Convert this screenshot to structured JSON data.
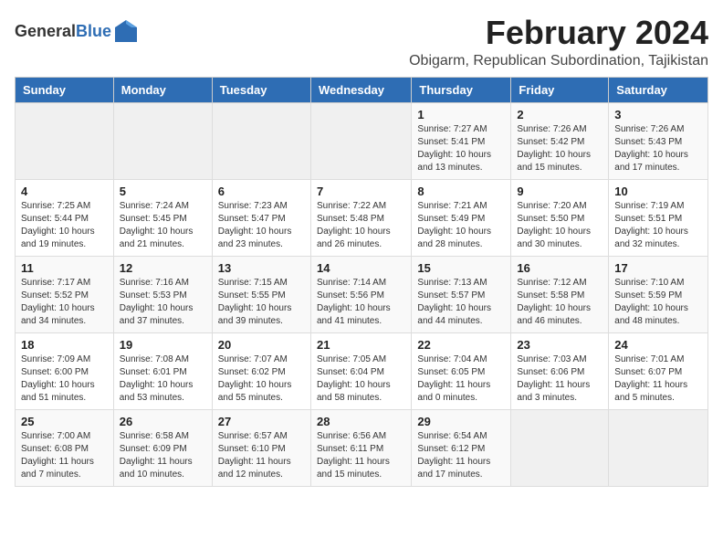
{
  "header": {
    "logo_general": "General",
    "logo_blue": "Blue",
    "month_title": "February 2024",
    "location": "Obigarm, Republican Subordination, Tajikistan"
  },
  "weekdays": [
    "Sunday",
    "Monday",
    "Tuesday",
    "Wednesday",
    "Thursday",
    "Friday",
    "Saturday"
  ],
  "weeks": [
    [
      {
        "day": "",
        "info": ""
      },
      {
        "day": "",
        "info": ""
      },
      {
        "day": "",
        "info": ""
      },
      {
        "day": "",
        "info": ""
      },
      {
        "day": "1",
        "info": "Sunrise: 7:27 AM\nSunset: 5:41 PM\nDaylight: 10 hours\nand 13 minutes."
      },
      {
        "day": "2",
        "info": "Sunrise: 7:26 AM\nSunset: 5:42 PM\nDaylight: 10 hours\nand 15 minutes."
      },
      {
        "day": "3",
        "info": "Sunrise: 7:26 AM\nSunset: 5:43 PM\nDaylight: 10 hours\nand 17 minutes."
      }
    ],
    [
      {
        "day": "4",
        "info": "Sunrise: 7:25 AM\nSunset: 5:44 PM\nDaylight: 10 hours\nand 19 minutes."
      },
      {
        "day": "5",
        "info": "Sunrise: 7:24 AM\nSunset: 5:45 PM\nDaylight: 10 hours\nand 21 minutes."
      },
      {
        "day": "6",
        "info": "Sunrise: 7:23 AM\nSunset: 5:47 PM\nDaylight: 10 hours\nand 23 minutes."
      },
      {
        "day": "7",
        "info": "Sunrise: 7:22 AM\nSunset: 5:48 PM\nDaylight: 10 hours\nand 26 minutes."
      },
      {
        "day": "8",
        "info": "Sunrise: 7:21 AM\nSunset: 5:49 PM\nDaylight: 10 hours\nand 28 minutes."
      },
      {
        "day": "9",
        "info": "Sunrise: 7:20 AM\nSunset: 5:50 PM\nDaylight: 10 hours\nand 30 minutes."
      },
      {
        "day": "10",
        "info": "Sunrise: 7:19 AM\nSunset: 5:51 PM\nDaylight: 10 hours\nand 32 minutes."
      }
    ],
    [
      {
        "day": "11",
        "info": "Sunrise: 7:17 AM\nSunset: 5:52 PM\nDaylight: 10 hours\nand 34 minutes."
      },
      {
        "day": "12",
        "info": "Sunrise: 7:16 AM\nSunset: 5:53 PM\nDaylight: 10 hours\nand 37 minutes."
      },
      {
        "day": "13",
        "info": "Sunrise: 7:15 AM\nSunset: 5:55 PM\nDaylight: 10 hours\nand 39 minutes."
      },
      {
        "day": "14",
        "info": "Sunrise: 7:14 AM\nSunset: 5:56 PM\nDaylight: 10 hours\nand 41 minutes."
      },
      {
        "day": "15",
        "info": "Sunrise: 7:13 AM\nSunset: 5:57 PM\nDaylight: 10 hours\nand 44 minutes."
      },
      {
        "day": "16",
        "info": "Sunrise: 7:12 AM\nSunset: 5:58 PM\nDaylight: 10 hours\nand 46 minutes."
      },
      {
        "day": "17",
        "info": "Sunrise: 7:10 AM\nSunset: 5:59 PM\nDaylight: 10 hours\nand 48 minutes."
      }
    ],
    [
      {
        "day": "18",
        "info": "Sunrise: 7:09 AM\nSunset: 6:00 PM\nDaylight: 10 hours\nand 51 minutes."
      },
      {
        "day": "19",
        "info": "Sunrise: 7:08 AM\nSunset: 6:01 PM\nDaylight: 10 hours\nand 53 minutes."
      },
      {
        "day": "20",
        "info": "Sunrise: 7:07 AM\nSunset: 6:02 PM\nDaylight: 10 hours\nand 55 minutes."
      },
      {
        "day": "21",
        "info": "Sunrise: 7:05 AM\nSunset: 6:04 PM\nDaylight: 10 hours\nand 58 minutes."
      },
      {
        "day": "22",
        "info": "Sunrise: 7:04 AM\nSunset: 6:05 PM\nDaylight: 11 hours\nand 0 minutes."
      },
      {
        "day": "23",
        "info": "Sunrise: 7:03 AM\nSunset: 6:06 PM\nDaylight: 11 hours\nand 3 minutes."
      },
      {
        "day": "24",
        "info": "Sunrise: 7:01 AM\nSunset: 6:07 PM\nDaylight: 11 hours\nand 5 minutes."
      }
    ],
    [
      {
        "day": "25",
        "info": "Sunrise: 7:00 AM\nSunset: 6:08 PM\nDaylight: 11 hours\nand 7 minutes."
      },
      {
        "day": "26",
        "info": "Sunrise: 6:58 AM\nSunset: 6:09 PM\nDaylight: 11 hours\nand 10 minutes."
      },
      {
        "day": "27",
        "info": "Sunrise: 6:57 AM\nSunset: 6:10 PM\nDaylight: 11 hours\nand 12 minutes."
      },
      {
        "day": "28",
        "info": "Sunrise: 6:56 AM\nSunset: 6:11 PM\nDaylight: 11 hours\nand 15 minutes."
      },
      {
        "day": "29",
        "info": "Sunrise: 6:54 AM\nSunset: 6:12 PM\nDaylight: 11 hours\nand 17 minutes."
      },
      {
        "day": "",
        "info": ""
      },
      {
        "day": "",
        "info": ""
      }
    ]
  ]
}
